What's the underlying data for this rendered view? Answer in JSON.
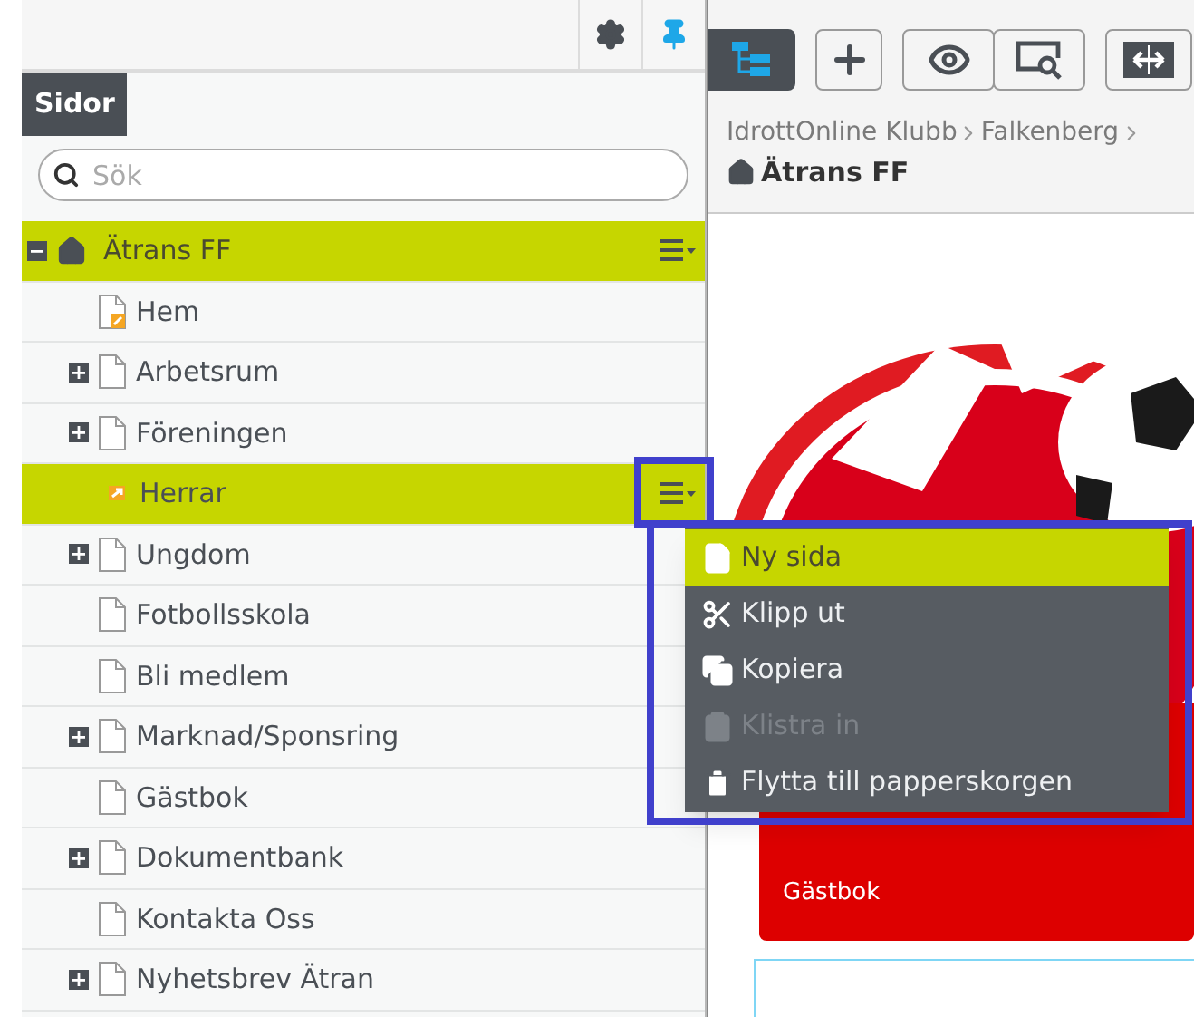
{
  "left_panel": {
    "tab": {
      "label": "Sidor",
      "selected": true
    },
    "search": {
      "placeholder": "Sök"
    }
  },
  "tree": {
    "label": "Ätrans FF",
    "selected": true,
    "expanded": true,
    "children": [
      {
        "label": "Hem",
        "kind": "start",
        "selected": false
      },
      {
        "label": "Arbetsrum",
        "kind": "branch",
        "selected": false
      },
      {
        "label": "Föreningen",
        "kind": "branch",
        "selected": false
      },
      {
        "label": "Herrar",
        "kind": "shortcut",
        "selected": true
      },
      {
        "label": "Ungdom",
        "kind": "branch",
        "selected": false
      },
      {
        "label": "Fotbollsskola",
        "kind": "page",
        "selected": false
      },
      {
        "label": "Bli medlem",
        "kind": "page",
        "selected": false
      },
      {
        "label": "Marknad/Sponsring",
        "kind": "branch",
        "selected": false
      },
      {
        "label": "Gästbok",
        "kind": "page",
        "selected": false
      },
      {
        "label": "Dokumentbank",
        "kind": "branch",
        "selected": false
      },
      {
        "label": "Kontakta Oss",
        "kind": "page",
        "selected": false
      },
      {
        "label": "Nyhetsbrev Ätran",
        "kind": "branch",
        "selected": false
      }
    ]
  },
  "toolbar": [
    {
      "kind": "tree",
      "selected": true
    },
    {
      "kind": "add",
      "selected": false
    },
    {
      "kind": "view",
      "selected": false
    },
    {
      "kind": "preview",
      "selected": false
    },
    {
      "kind": "compare",
      "selected": false
    }
  ],
  "breadcrumb": {
    "path": [
      "IdrottOnline Klubb",
      "Falkenberg"
    ],
    "current": "Ätrans FF"
  },
  "site_nav": {
    "items": [
      "Gästbok"
    ]
  },
  "context_menu": {
    "items": [
      {
        "label": "Ny sida",
        "kind": "new",
        "selected": true,
        "disabled": false
      },
      {
        "label": "Klipp ut",
        "kind": "cut",
        "selected": false,
        "disabled": false
      },
      {
        "label": "Kopiera",
        "kind": "copy",
        "selected": false,
        "disabled": false
      },
      {
        "label": "Klistra in",
        "kind": "paste",
        "selected": false,
        "disabled": true
      },
      {
        "label": "Flytta till papperskorgen",
        "kind": "trash",
        "selected": false,
        "disabled": false
      }
    ]
  }
}
